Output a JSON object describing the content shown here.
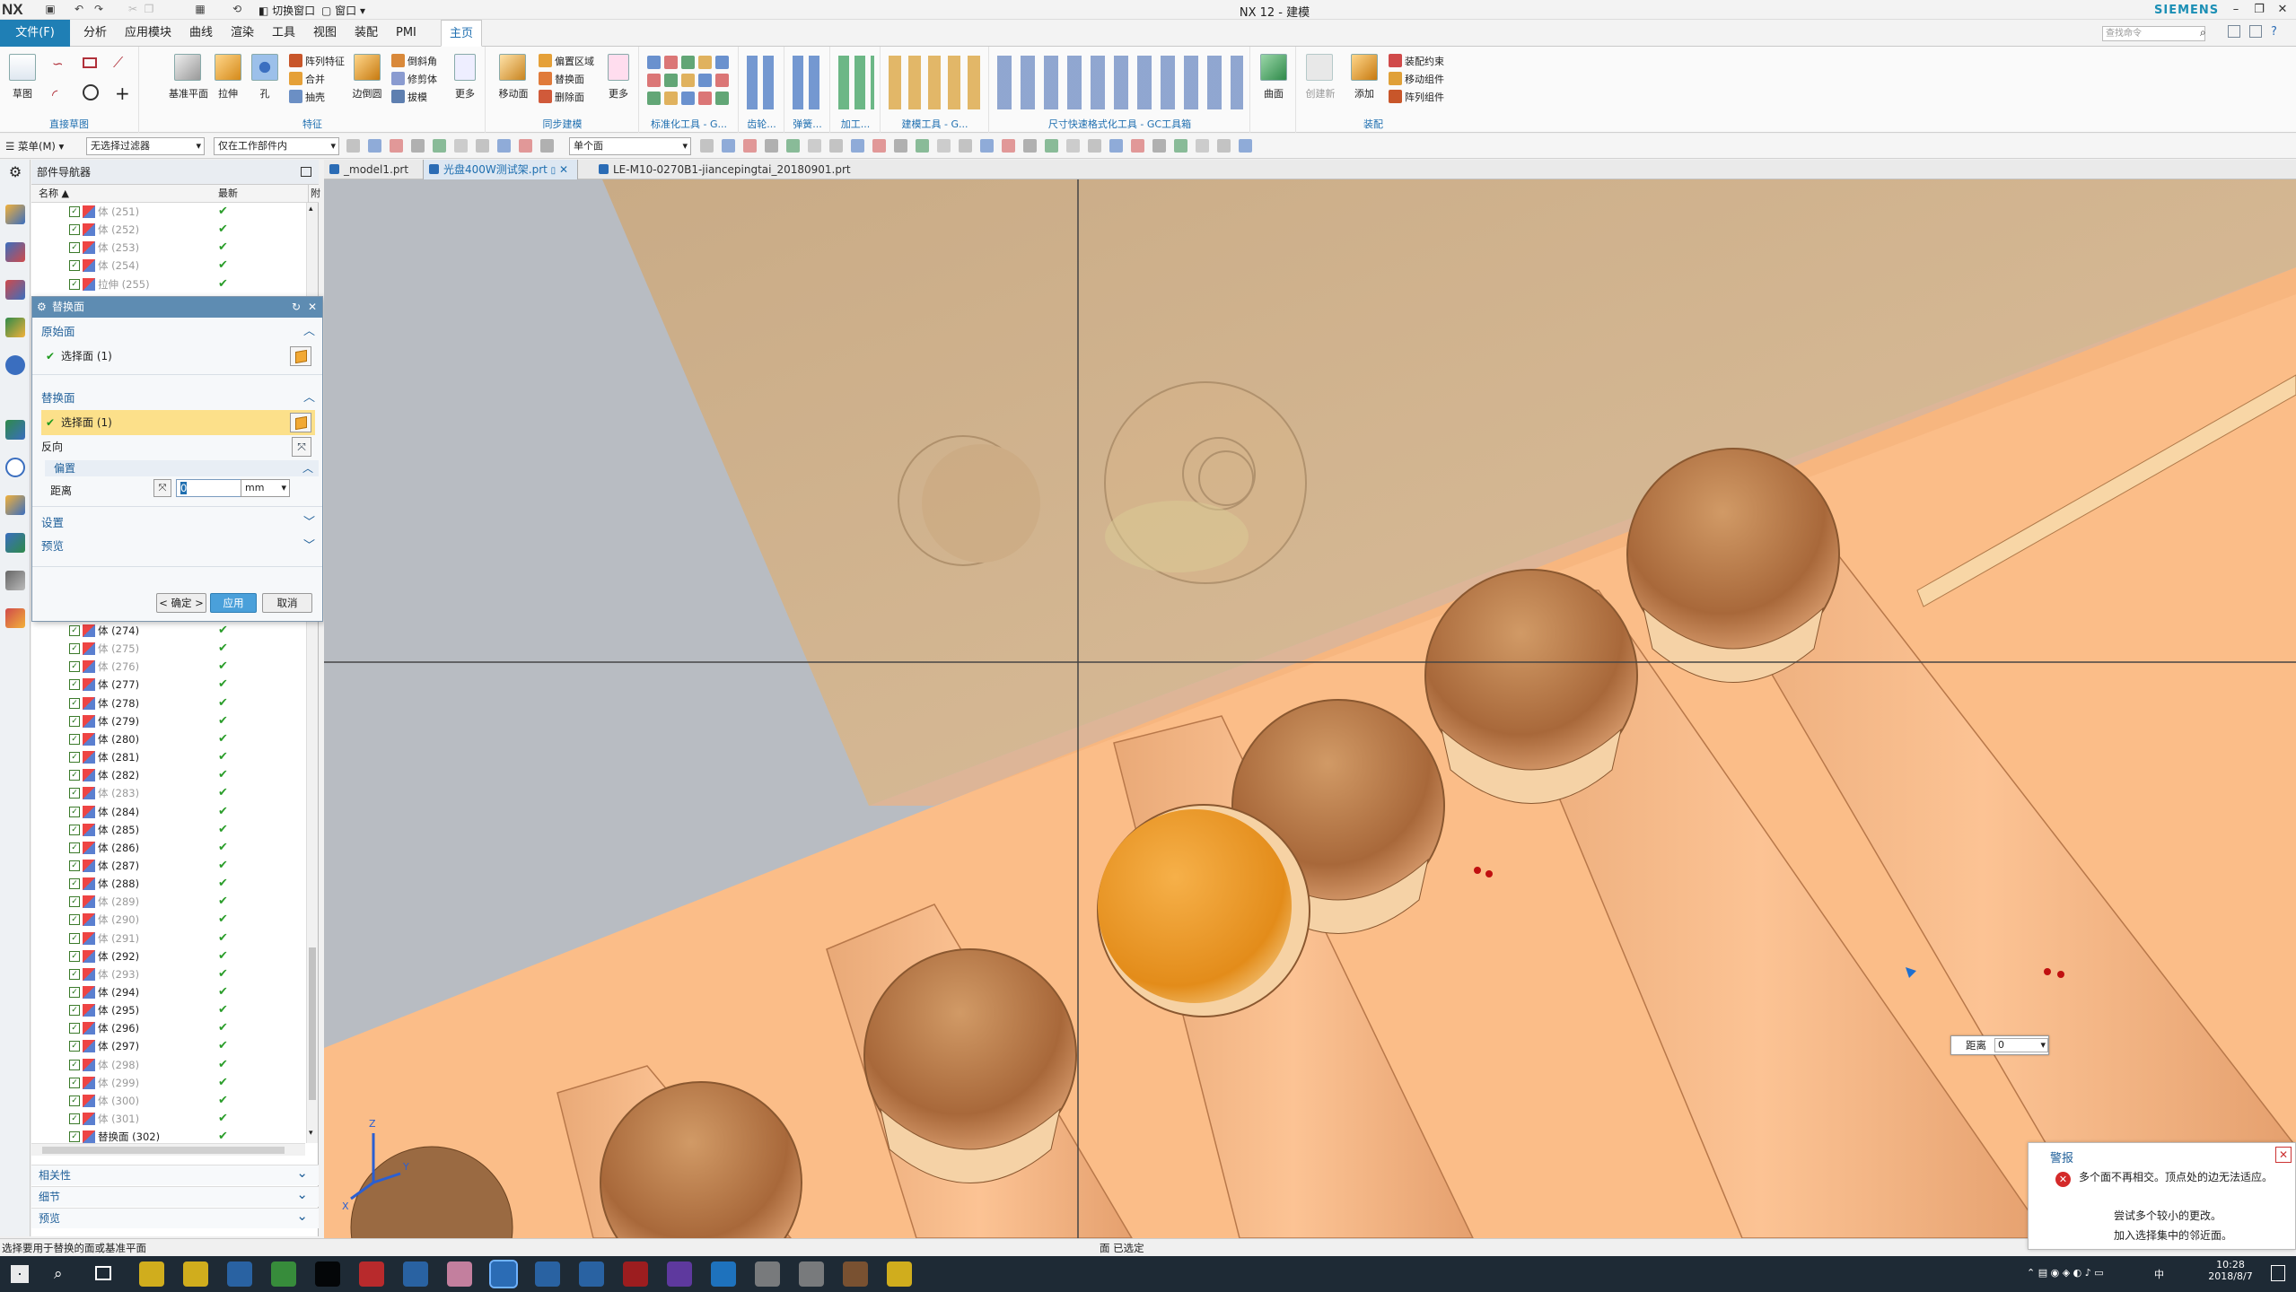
{
  "titlebar": {
    "logo": "NX",
    "title": "NX 12 - 建模",
    "brand": "SIEMENS",
    "switch_window": "切换窗口",
    "window": "窗口"
  },
  "menu": {
    "file": "文件(F)",
    "tabs": [
      "分析",
      "应用模块",
      "曲线",
      "渲染",
      "工具",
      "视图",
      "装配",
      "PMI",
      "主页"
    ],
    "active": "主页",
    "search_placeholder": "查找命令"
  },
  "ribbon": {
    "groups": [
      {
        "label": "直接草图",
        "items": [
          "草图"
        ]
      },
      {
        "label": "特征",
        "items": [
          "基准平面",
          "拉伸",
          "孔",
          "阵列特征",
          "合并",
          "抽壳",
          "边倒圆",
          "倒斜角",
          "修剪体",
          "拔模",
          "更多"
        ]
      },
      {
        "label": "同步建模",
        "items": [
          "移动面",
          "偏置区域",
          "替换面",
          "删除面",
          "更多"
        ]
      },
      {
        "label": "标准化工具 - G...",
        "items": []
      },
      {
        "label": "齿轮...",
        "items": []
      },
      {
        "label": "弹簧...",
        "items": []
      },
      {
        "label": "加工...",
        "items": []
      },
      {
        "label": "建模工具 - G...",
        "items": []
      },
      {
        "label": "尺寸快速格式化工具 - GC工具箱",
        "items": []
      },
      {
        "label": "",
        "items": [
          "曲面"
        ]
      },
      {
        "label": "装配",
        "items": [
          "创建新",
          "添加",
          "装配约束",
          "移动组件",
          "阵列组件"
        ]
      }
    ]
  },
  "seltoolbar": {
    "menu": "菜单(M)",
    "filter": "无选择过滤器",
    "scope": "仅在工作部件内",
    "mode": "单个面"
  },
  "navigator": {
    "title": "部件导航器",
    "col_name": "名称",
    "col_latest": "最新",
    "top_rows": [
      {
        "label": "体 (251)",
        "gray": true
      },
      {
        "label": "体 (252)",
        "gray": true
      },
      {
        "label": "体 (253)",
        "gray": true
      },
      {
        "label": "体 (254)",
        "gray": true
      },
      {
        "label": "拉伸 (255)",
        "gray": true
      }
    ],
    "rows": [
      {
        "label": "体 (274)",
        "gray": false
      },
      {
        "label": "体 (275)",
        "gray": true
      },
      {
        "label": "体 (276)",
        "gray": true
      },
      {
        "label": "体 (277)",
        "gray": false
      },
      {
        "label": "体 (278)",
        "gray": false
      },
      {
        "label": "体 (279)",
        "gray": false
      },
      {
        "label": "体 (280)",
        "gray": false
      },
      {
        "label": "体 (281)",
        "gray": false
      },
      {
        "label": "体 (282)",
        "gray": false
      },
      {
        "label": "体 (283)",
        "gray": true
      },
      {
        "label": "体 (284)",
        "gray": false
      },
      {
        "label": "体 (285)",
        "gray": false
      },
      {
        "label": "体 (286)",
        "gray": false
      },
      {
        "label": "体 (287)",
        "gray": false
      },
      {
        "label": "体 (288)",
        "gray": false
      },
      {
        "label": "体 (289)",
        "gray": true
      },
      {
        "label": "体 (290)",
        "gray": true
      },
      {
        "label": "体 (291)",
        "gray": true
      },
      {
        "label": "体 (292)",
        "gray": false
      },
      {
        "label": "体 (293)",
        "gray": true
      },
      {
        "label": "体 (294)",
        "gray": false
      },
      {
        "label": "体 (295)",
        "gray": false
      },
      {
        "label": "体 (296)",
        "gray": false
      },
      {
        "label": "体 (297)",
        "gray": false
      },
      {
        "label": "体 (298)",
        "gray": true
      },
      {
        "label": "体 (299)",
        "gray": true
      },
      {
        "label": "体 (300)",
        "gray": true
      },
      {
        "label": "体 (301)",
        "gray": true
      },
      {
        "label": "替换面 (302)",
        "gray": false
      }
    ],
    "footer": [
      "相关性",
      "细节",
      "预览"
    ]
  },
  "dialog": {
    "title": "替换面",
    "original": "原始面",
    "select_original": "选择面 (1)",
    "replacement": "替换面",
    "select_replacement": "选择面 (1)",
    "reverse": "反向",
    "offset": "偏置",
    "distance_label": "距离",
    "distance_value": "0",
    "unit": "mm",
    "settings": "设置",
    "preview": "预览",
    "ok": "< 确定 >",
    "apply": "应用",
    "cancel": "取消"
  },
  "tabs": [
    "_model1.prt",
    "光盘400W测试架.prt",
    "LE-M10-0270B1-jiancepingtai_20180901.prt"
  ],
  "active_tab": "光盘400W测试架.prt",
  "viewport": {
    "distance_label": "距离",
    "distance_value": "0"
  },
  "alert": {
    "title": "警报",
    "line1": "多个面不再相交。顶点处的边无法适应。",
    "line2": "尝试多个较小的更改。",
    "line3": "加入选择集中的邻近面。"
  },
  "status": {
    "left": "选择要用于替换的面或基准平面",
    "center": "面 已选定"
  },
  "taskbar": {
    "time": "10:28",
    "date": "2018/8/7",
    "lang": "中"
  },
  "colors": {
    "accent": "#1f7fb5",
    "part": "#fbc08a",
    "hole": "#e8a04a",
    "ok": "#2a9d2a"
  }
}
